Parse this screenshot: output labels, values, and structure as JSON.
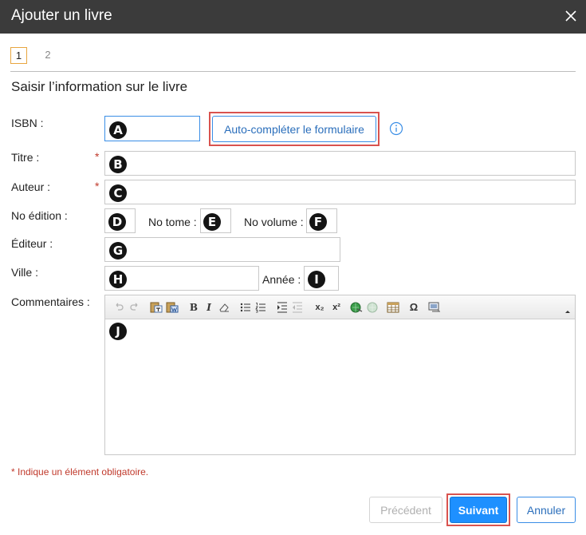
{
  "dialog": {
    "title": "Ajouter un livre",
    "close_icon": "close-icon"
  },
  "steps": [
    "1",
    "2"
  ],
  "active_step": "1",
  "section_title": "Saisir l’information sur le livre",
  "fields": {
    "isbn": {
      "label": "ISBN :",
      "value": "",
      "marker": "A"
    },
    "titre": {
      "label": "Titre :",
      "value": "",
      "marker": "B",
      "required": "*"
    },
    "auteur": {
      "label": "Auteur :",
      "value": "",
      "marker": "C",
      "required": "*"
    },
    "no_edition": {
      "label": "No édition :",
      "value": "",
      "marker": "D"
    },
    "no_tome": {
      "label": "No tome :",
      "value": "",
      "marker": "E"
    },
    "no_volume": {
      "label": "No volume :",
      "value": "",
      "marker": "F"
    },
    "editeur": {
      "label": "Éditeur :",
      "value": "",
      "marker": "G"
    },
    "ville": {
      "label": "Ville :",
      "value": "",
      "marker": "H"
    },
    "annee": {
      "label": "Année :",
      "value": "",
      "marker": "I"
    },
    "commentaires": {
      "label": "Commentaires :",
      "value": "",
      "marker": "J"
    }
  },
  "autofill_label": "Auto-compléter le formulaire",
  "info_icon": "info-icon",
  "toolbar_icons": [
    "undo-icon",
    "redo-icon",
    "paste-text-icon",
    "paste-word-icon",
    "bold-icon",
    "italic-icon",
    "remove-format-icon",
    "bulleted-list-icon",
    "numbered-list-icon",
    "indent-icon",
    "outdent-icon",
    "subscript-icon",
    "superscript-icon",
    "link-icon",
    "unlink-icon",
    "table-icon",
    "special-char-icon",
    "image-icon"
  ],
  "toolbar_glyphs": {
    "bold": "B",
    "italic": "I",
    "subscript": "x₂",
    "superscript": "x²",
    "omega": "Ω"
  },
  "required_note": "* Indique un élément obligatoire.",
  "buttons": {
    "previous": "Précédent",
    "next": "Suivant",
    "cancel": "Annuler"
  },
  "colors": {
    "titlebar": "#3b3b3b",
    "accent": "#1e90ff",
    "required": "#c0392b",
    "highlight": "#d9534f"
  }
}
